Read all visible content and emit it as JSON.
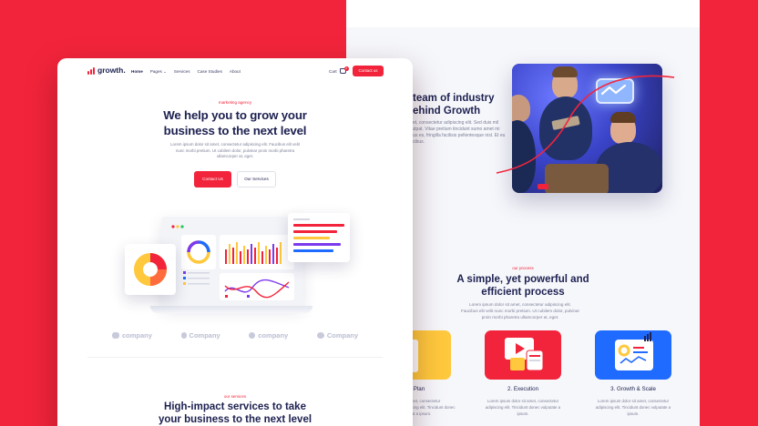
{
  "colors": {
    "accent": "#f2243b",
    "navy": "#1d2150",
    "muted": "#7d8098",
    "yellow": "#ffc83d",
    "blue": "#1f6bff"
  },
  "back_page": {
    "team_title": "t team of industry\nbehind Growth",
    "team_text": "amet, consectetur adipiscing elit. Sed duis mil volutpat. Vitae pretium tincidunt sumo amet mi purus es, fringilla facilisis pellentesque nisl. Et eu faucibus.",
    "photo_icon": "team-photo",
    "process": {
      "eyebrow": "our process",
      "title": "A simple, yet powerful and efficient process",
      "subtitle": "Lorem ipsum dolor sit amet, consectetur adipiscing elit. Faucibus elit velit nunc morbi pretium. Ut cubilem dolor, pulvinar proin morbi pharetra ullamcorper at, eget."
    },
    "steps": [
      {
        "title": "rting Plan",
        "text": "r sit amet, consectetur adipiscing elit. Tincidunt donec volutpat a ipsum.",
        "icon": "document-icon",
        "color": "#ffc83d"
      },
      {
        "title": "2. Execution",
        "text": "Lorem ipsum dolor sit amet, consectetur adipiscing elit. Tincidunt donec vulputate a ipsum.",
        "icon": "media-window-icon",
        "color": "#f2243b"
      },
      {
        "title": "3. Growth & Scale",
        "text": "Lorem ipsum dolor sit amet, consectetur adipiscing elit. Tincidunt donec vulputate a ipsum.",
        "icon": "analytics-window-icon",
        "color": "#1f6bff"
      }
    ]
  },
  "front_page": {
    "logo_text": "growth.",
    "nav": [
      "Home",
      "Pages ⌄",
      "Services",
      "Case Studies",
      "About"
    ],
    "cart_label": "Cart",
    "cart_count": "0",
    "cta_label": "Contact us",
    "hero": {
      "eyebrow": "marketing agency",
      "title": "We help you to grow your business to the next level",
      "subtitle": "Lorem ipsum dolor sit amet, consectetur adipiscing elit. Faucibus elit velit nunc morbi pretium. Ut cubilem dolor, pulvinar proin morbi pharetra ullamcorper at, eget.",
      "primary_button": "Contact Us",
      "secondary_button": "Our Services"
    },
    "company_logos": [
      "company",
      "Company",
      "company",
      "Company"
    ],
    "services": {
      "eyebrow": "our services",
      "title": "High-impact services to take your business to the next level"
    }
  }
}
